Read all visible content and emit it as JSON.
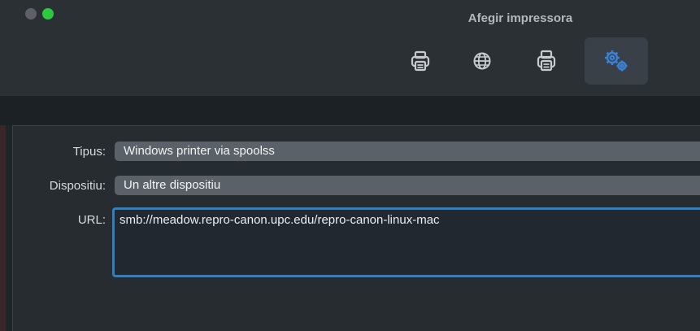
{
  "window": {
    "title": "Afegir impressora"
  },
  "toolbar": {
    "buttons": [
      {
        "icon": "printer-icon",
        "selected": false
      },
      {
        "icon": "globe-icon",
        "selected": false
      },
      {
        "icon": "fax-printer-icon",
        "selected": false
      },
      {
        "icon": "gears-icon",
        "selected": true
      }
    ]
  },
  "form": {
    "type_label": "Tipus:",
    "type_value": "Windows printer via spoolss",
    "device_label": "Dispositiu:",
    "device_value": "Un altre dispositiu",
    "url_label": "URL:",
    "url_value": "smb://meadow.repro-canon.upc.edu/repro-canon-linux-mac"
  },
  "colors": {
    "accent": "#2f7fc1",
    "selected_icon": "#3b82d6"
  }
}
